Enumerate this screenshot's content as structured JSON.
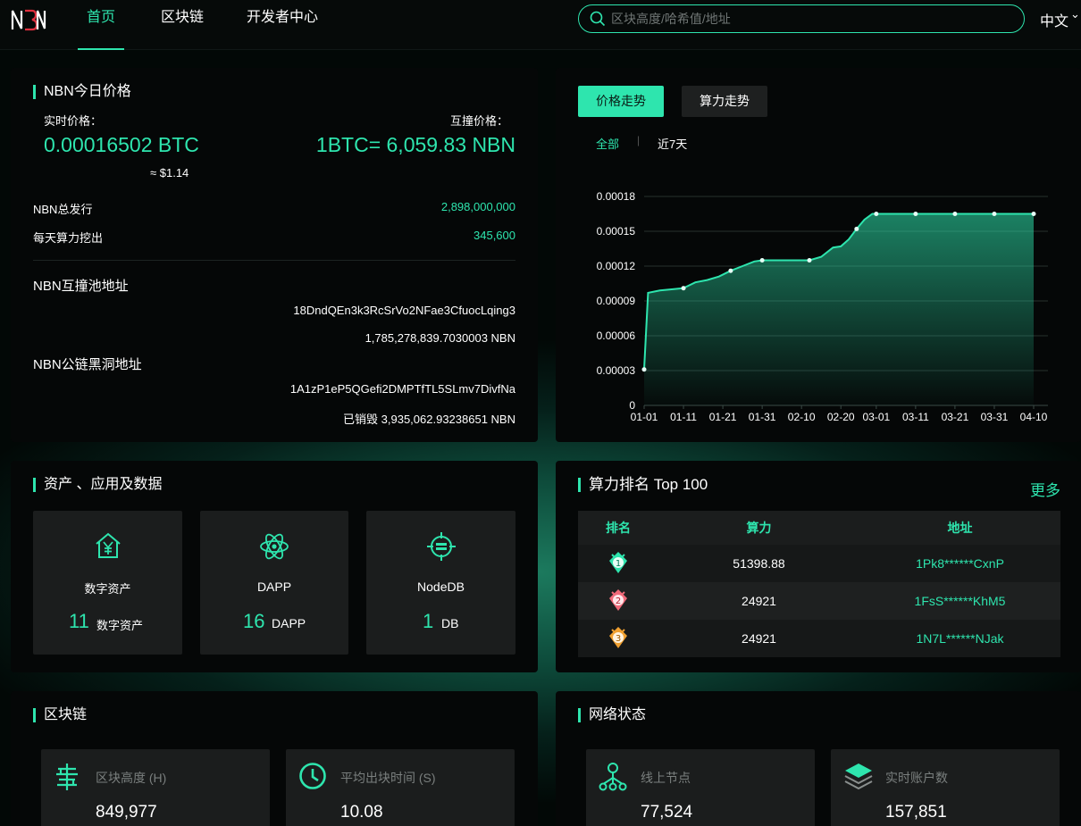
{
  "nav": {
    "logo": "NBN",
    "tabs": [
      {
        "label": "首页",
        "active": true
      },
      {
        "label": "区块链",
        "active": false
      },
      {
        "label": "开发者中心",
        "active": false
      }
    ],
    "search_placeholder": "区块高度/哈希值/地址",
    "language": "中文"
  },
  "price_card": {
    "title": "NBN今日价格",
    "realtime_label": "实时价格：",
    "realtime_value": "0.00016502 BTC",
    "usd_value": "≈ $1.14",
    "exchange_label": "互撞价格：",
    "exchange_value": "1BTC= 6,059.83 NBN",
    "total_label": "NBN总发行",
    "total_value": "2,898,000,000",
    "daily_label": "每天算力挖出",
    "daily_value": "345,600",
    "pool_title": "NBN互撞池地址",
    "pool_address": "18DndQEn3k3RcSrVo2NFae3CfuocLqing3",
    "pool_amount": "1,785,278,839.7030003 NBN",
    "blackhole_title": "NBN公链黑洞地址",
    "blackhole_address": "1A1zP1eP5QGefi2DMPTfTL5SLmv7DivfNa",
    "burned": "已销毁 3,935,062.93238651 NBN"
  },
  "chart_panel": {
    "tab_price": "价格走势",
    "tab_hash": "算力走势",
    "range_all": "全部",
    "range_separator": "|",
    "range_7d": "近7天"
  },
  "chart_data": {
    "type": "area",
    "title": "",
    "xlabel": "",
    "ylabel": "",
    "x_ticks": [
      "01-01",
      "01-11",
      "01-21",
      "01-31",
      "02-10",
      "02-20",
      "03-01",
      "03-11",
      "03-21",
      "03-31",
      "04-10"
    ],
    "y_ticks": [
      "0",
      "0.00003",
      "0.00006",
      "0.00009",
      "0.00012",
      "0.00015",
      "0.00018"
    ],
    "ylim": [
      0,
      0.00018
    ],
    "grid": true,
    "color": "#2ee5ae",
    "series": [
      {
        "x": [
          "01-01",
          "01-02",
          "01-05",
          "01-08",
          "01-11",
          "01-14",
          "01-17",
          "01-20",
          "01-23",
          "01-26",
          "01-29",
          "01-31",
          "02-03",
          "02-06",
          "02-09",
          "02-12",
          "02-15",
          "02-18",
          "02-20",
          "02-22",
          "02-24",
          "02-26",
          "02-28",
          "03-01",
          "03-05",
          "03-11",
          "03-16",
          "03-21",
          "03-26",
          "03-31",
          "04-05",
          "04-10"
        ],
        "values": [
          3.1e-05,
          9.7e-05,
          9.9e-05,
          0.0001,
          0.000101,
          0.000106,
          0.000108,
          0.000111,
          0.000116,
          0.00012,
          0.000124,
          0.000125,
          0.000125,
          0.000125,
          0.000125,
          0.000125,
          0.000128,
          0.000136,
          0.000137,
          0.000143,
          0.000152,
          0.00016,
          0.000165,
          0.000165,
          0.000165,
          0.000165,
          0.000165,
          0.000165,
          0.000165,
          0.000165,
          0.000165,
          0.000165
        ]
      }
    ]
  },
  "assets_card": {
    "title": "资产 、应用及数据",
    "tiles": [
      {
        "label": "数字资产",
        "count": "11",
        "unit": "数字资产"
      },
      {
        "label": "DAPP",
        "count": "16",
        "unit": "DAPP"
      },
      {
        "label": "NodeDB",
        "count": "1",
        "unit": "DB"
      }
    ]
  },
  "ranking_card": {
    "title": "算力排名 Top 100",
    "more": "更多",
    "columns": [
      "排名",
      "算力",
      "地址"
    ],
    "rows": [
      {
        "rank": "1",
        "hash": "51398.88",
        "address": "1Pk8******CxnP"
      },
      {
        "rank": "2",
        "hash": "24921",
        "address": "1FsS******KhM5"
      },
      {
        "rank": "3",
        "hash": "24921",
        "address": "1N7L******NJak"
      }
    ]
  },
  "blockchain_card": {
    "title": "区块链",
    "stats": [
      {
        "label": "区块高度 (H)",
        "value": "849,977"
      },
      {
        "label": "平均出块时间 (S)",
        "value": "10.08"
      }
    ]
  },
  "network_card": {
    "title": "网络状态",
    "stats": [
      {
        "label": "线上节点",
        "value": "77,524"
      },
      {
        "label": "实时账户数",
        "value": "157,851"
      }
    ]
  }
}
